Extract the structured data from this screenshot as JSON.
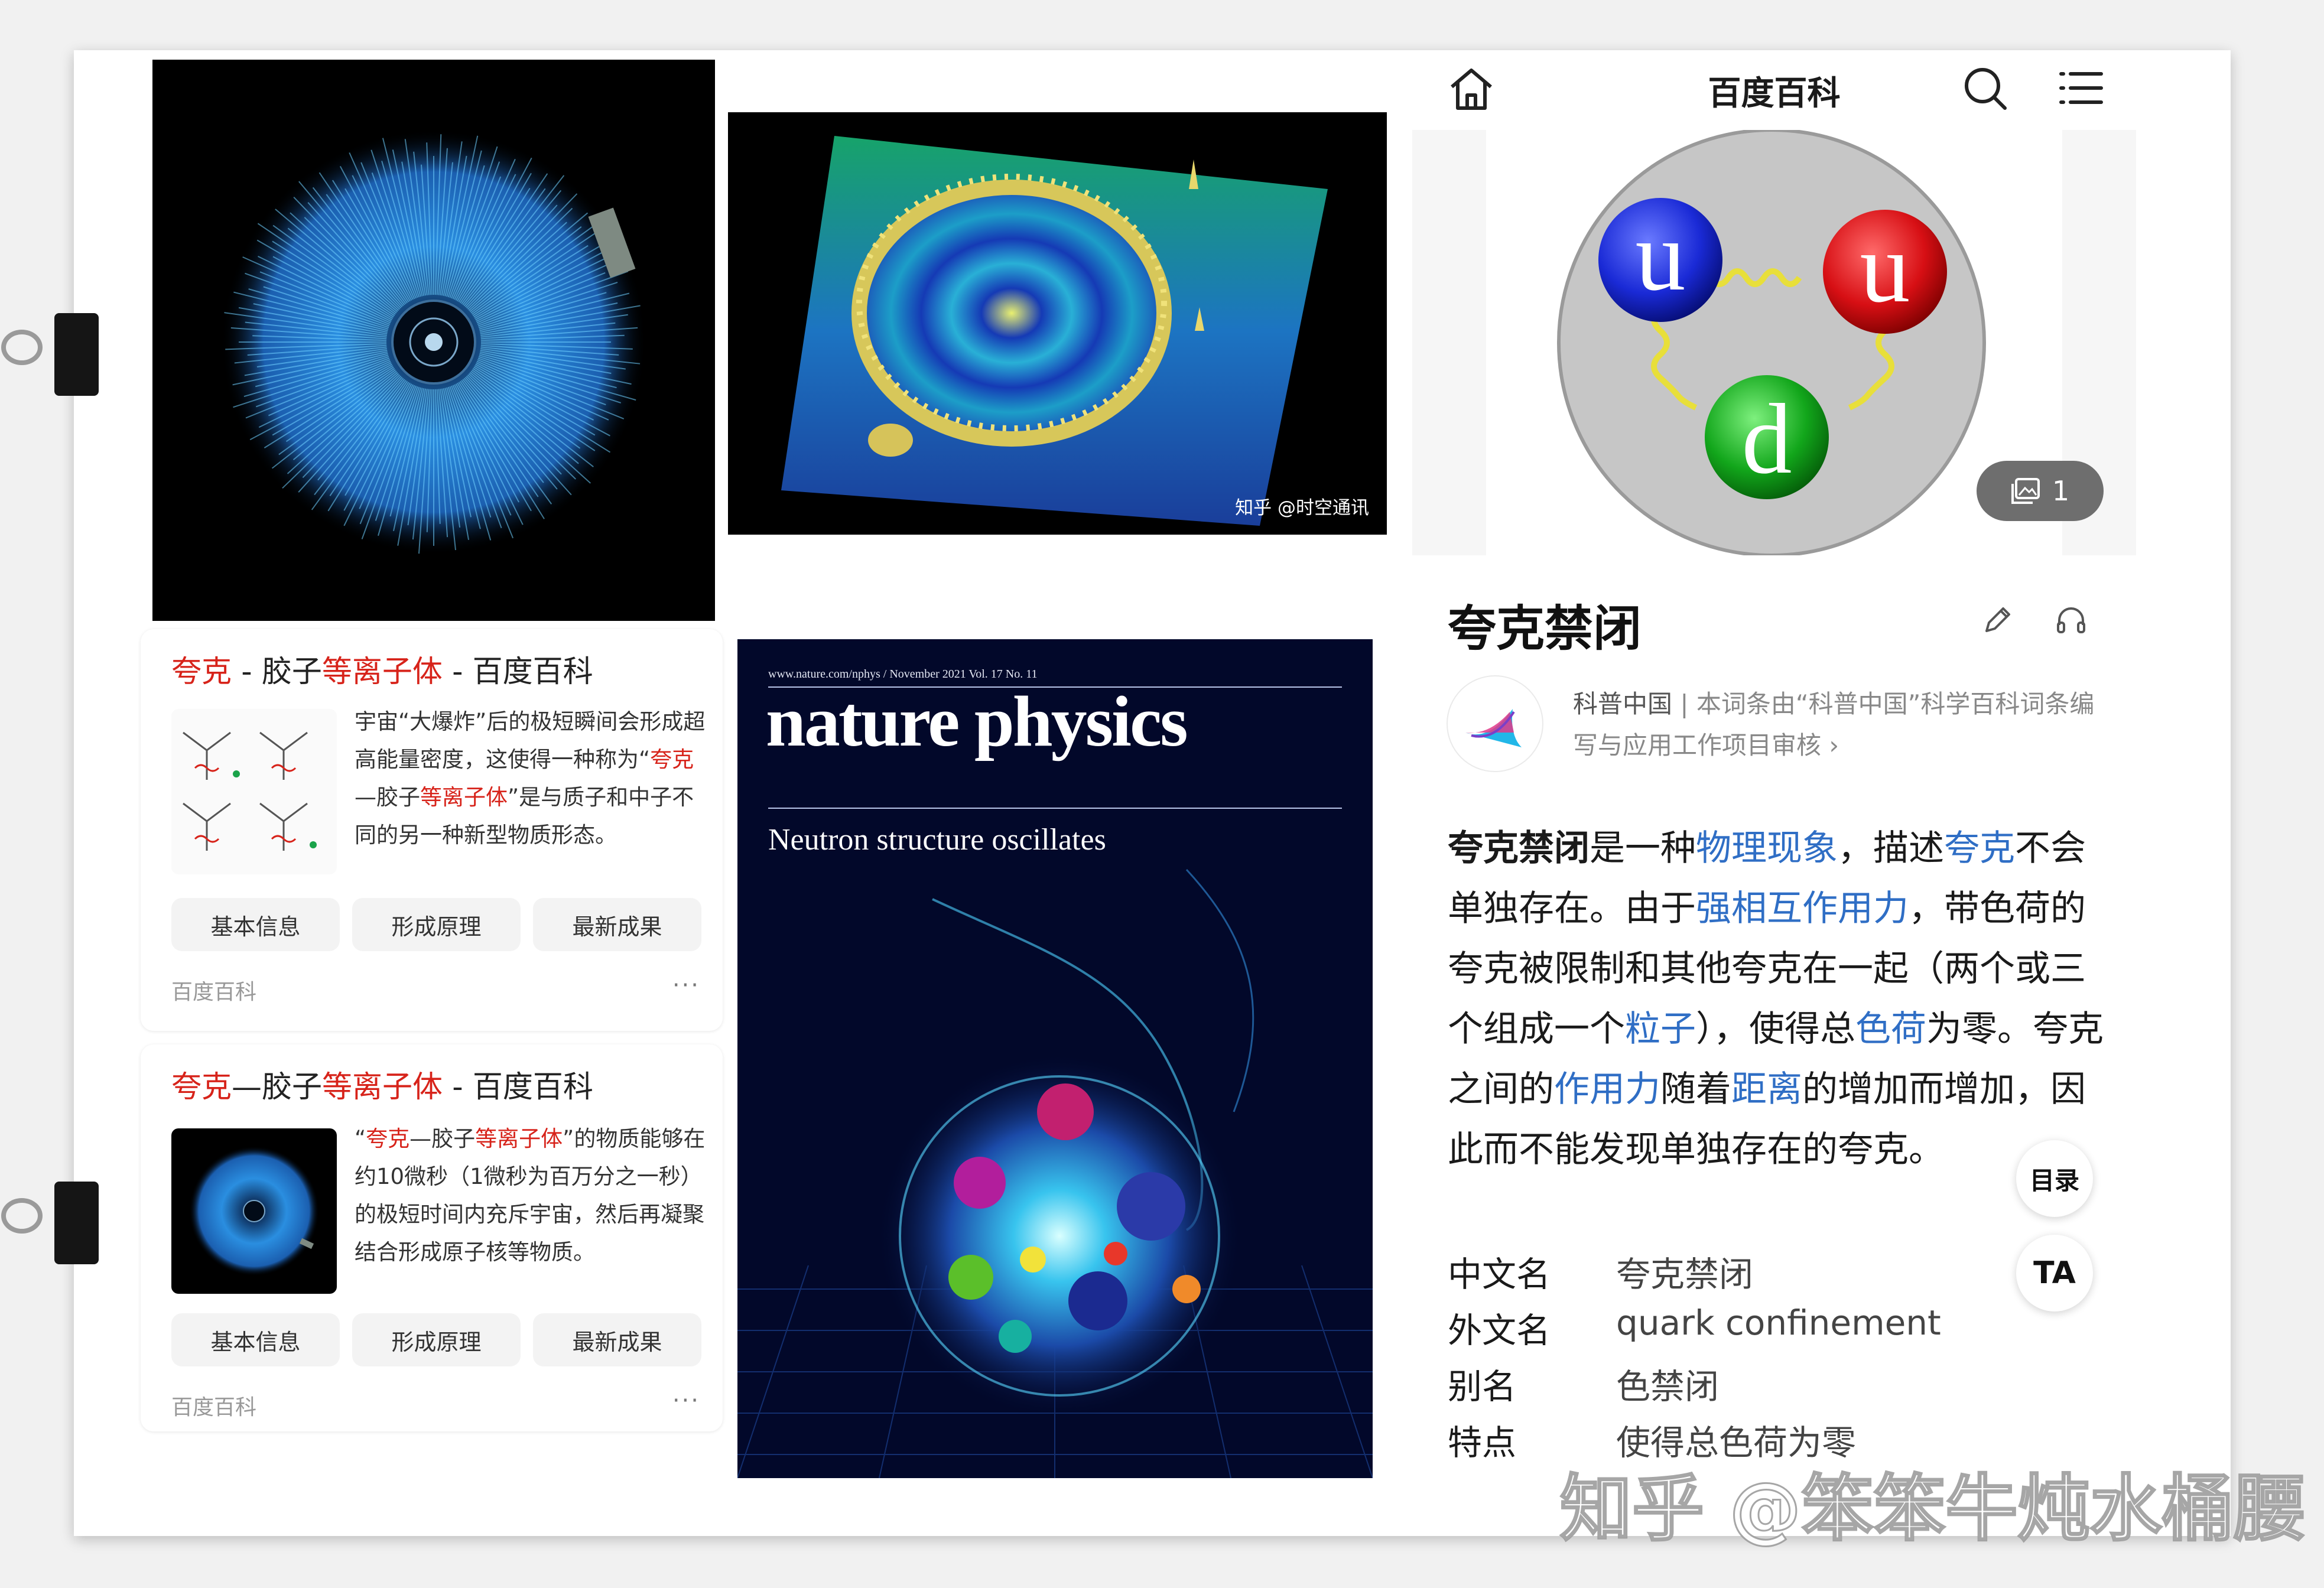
{
  "corral_photo": {
    "caption": "知乎 @时空通讯"
  },
  "cards": [
    {
      "title_parts": [
        "夸克",
        " - 胶子",
        "等离子体",
        " - 百度百科"
      ],
      "text_html": "宇宙“大爆炸”后的极短瞬间会形成超高能量密度，这使得一种称为“<span class='hl'>夸克</span>—胶子<span class='hl'>等离子体</span>”是与质子和中子不同的另一种新型物质形态。",
      "buttons": [
        "基本信息",
        "形成原理",
        "最新成果"
      ],
      "source": "百度百科",
      "more": "···"
    },
    {
      "title_parts": [
        "夸克",
        "—胶子",
        "等离子体",
        " - 百度百科"
      ],
      "text_html": "“<span class='hl'>夸克</span>—胶子<span class='hl'>等离子体</span>”的物质能够在约10微秒（1微秒为百万分之一秒）的极短时间内充斥宇宙，然后再凝聚结合形成原子核等物质。",
      "buttons": [
        "基本信息",
        "形成原理",
        "最新成果"
      ],
      "source": "百度百科",
      "more": "···"
    }
  ],
  "nature": {
    "top_line": "www.nature.com/nphys / November 2021 Vol. 17 No. 11",
    "title": "nature physics",
    "headline": "Neutron structure oscillates"
  },
  "baike": {
    "brand": "百度百科",
    "hero": {
      "quarks": [
        "u",
        "u",
        "d"
      ],
      "gallery_count": "1"
    },
    "title": "夸克禁闭",
    "credit_name": "科普中国",
    "credit_text": " | 本词条由“科普中国”科学百科词条编写与应用工作项目审核 ›",
    "body_html": "<span class='b'>夸克禁闭</span>是一种<span class='lk'>物理现象</span>，描述<span class='lk'>夸克</span>不会单独存在。由于<span class='lk'>强相互作用力</span>，带色荷的夸克被限制和其他夸克在一起（两个或三个组成一个<span class='lk'>粒子</span>），使得总<span class='lk'>色荷</span>为零。夸克之间的<span class='lk'>作用力</span>随着<span class='lk'>距离</span>的增加而增加，因此而不能发现单独存在的夸克。",
    "toc_button": "目录",
    "ta_button": "TA",
    "info": [
      {
        "k": "中文名",
        "v": "夸克禁闭"
      },
      {
        "k": "外文名",
        "v": "quark confinement"
      },
      {
        "k": "别名",
        "v": "色禁闭"
      },
      {
        "k": "特点",
        "v": "使得总色荷为零"
      }
    ]
  },
  "watermark": "知乎 @笨笨牛炖水桶腰",
  "colors": {
    "highlight": "#d7231a",
    "link": "#2f6ec5",
    "quark_u": "#d70f14",
    "quark_u2": "#1a2ad6",
    "quark_d": "#12a61b"
  }
}
